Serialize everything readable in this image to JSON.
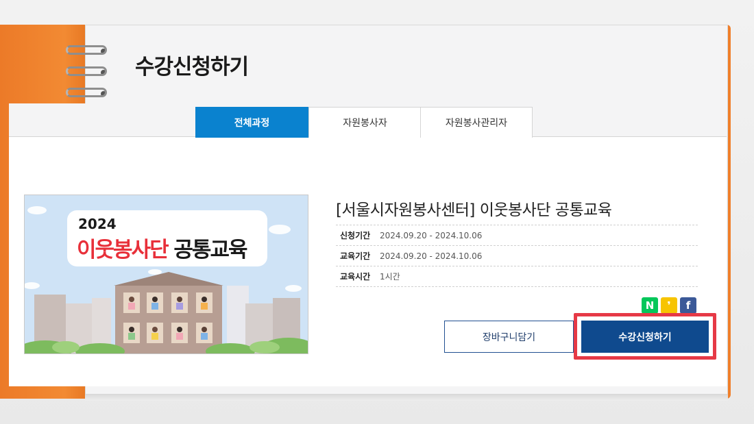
{
  "page": {
    "title": "수강신청하기"
  },
  "tabs": [
    {
      "label": "전체과정",
      "active": true
    },
    {
      "label": "자원봉사자",
      "active": false
    },
    {
      "label": "자원봉사관리자",
      "active": false
    }
  ],
  "banner": {
    "year": "2024",
    "title_red": "이웃봉사단",
    "title_black": "공통교육"
  },
  "course": {
    "title": "[서울시자원봉사센터] 이웃봉사단 공통교육",
    "info": [
      {
        "label": "신청기간",
        "value": "2024.09.20 - 2024.10.06"
      },
      {
        "label": "교육기간",
        "value": "2024.09.20 - 2024.10.06"
      },
      {
        "label": "교육시간",
        "value": "1시간"
      }
    ]
  },
  "share": {
    "naver": "N",
    "kakao": "❜",
    "facebook": "f"
  },
  "buttons": {
    "cart": "장바구니담기",
    "apply": "수강신청하기"
  },
  "colors": {
    "accent": "#0a82cf",
    "primary_button": "#0f4a8e",
    "highlight": "#e63946",
    "binder": "#f07f2a"
  }
}
